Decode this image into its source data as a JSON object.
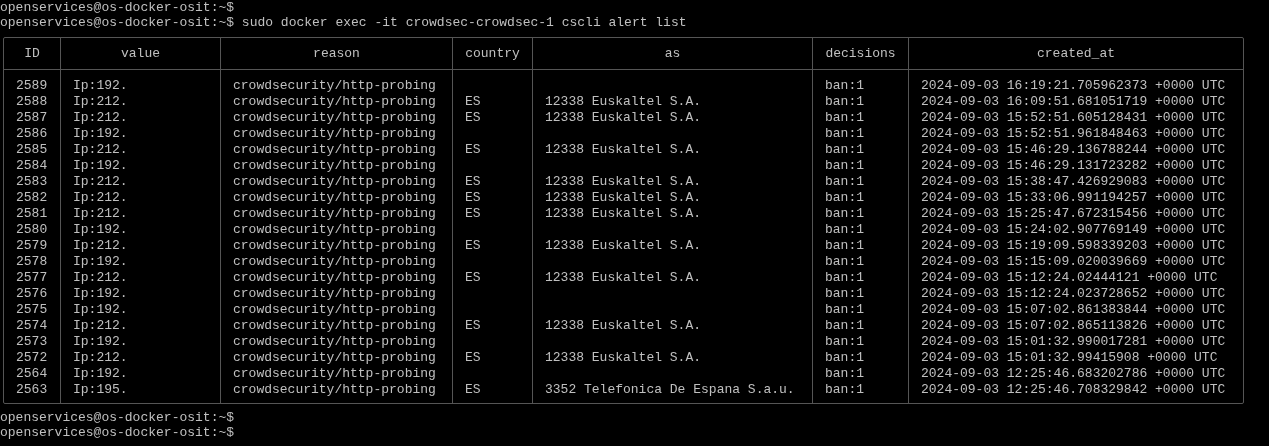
{
  "terminal": {
    "lines_before": [
      "openservices@os-docker-osit:~$",
      "openservices@os-docker-osit:~$ sudo docker exec -it crowdsec-crowdsec-1 cscli alert list"
    ],
    "table": {
      "columns": [
        "ID",
        "value",
        "reason",
        "country",
        "as",
        "decisions",
        "created_at"
      ],
      "rows": [
        {
          "id": "2589",
          "value": "Ip:192.",
          "reason": "crowdsecurity/http-probing",
          "decisions": "ban:1",
          "created_at": "2024-09-03 16:19:21.705962373 +0000 UTC"
        },
        {
          "id": "2588",
          "value": "Ip:212.",
          "reason": "crowdsecurity/http-probing",
          "country": "ES",
          "as": "12338 Euskaltel S.A.",
          "decisions": "ban:1",
          "created_at": "2024-09-03 16:09:51.681051719 +0000 UTC"
        },
        {
          "id": "2587",
          "value": "Ip:212.",
          "reason": "crowdsecurity/http-probing",
          "country": "ES",
          "as": "12338 Euskaltel S.A.",
          "decisions": "ban:1",
          "created_at": "2024-09-03 15:52:51.605128431 +0000 UTC"
        },
        {
          "id": "2586",
          "value": "Ip:192.",
          "reason": "crowdsecurity/http-probing",
          "decisions": "ban:1",
          "created_at": "2024-09-03 15:52:51.961848463 +0000 UTC"
        },
        {
          "id": "2585",
          "value": "Ip:212.",
          "reason": "crowdsecurity/http-probing",
          "country": "ES",
          "as": "12338 Euskaltel S.A.",
          "decisions": "ban:1",
          "created_at": "2024-09-03 15:46:29.136788244 +0000 UTC"
        },
        {
          "id": "2584",
          "value": "Ip:192.",
          "reason": "crowdsecurity/http-probing",
          "decisions": "ban:1",
          "created_at": "2024-09-03 15:46:29.131723282 +0000 UTC"
        },
        {
          "id": "2583",
          "value": "Ip:212.",
          "reason": "crowdsecurity/http-probing",
          "country": "ES",
          "as": "12338 Euskaltel S.A.",
          "decisions": "ban:1",
          "created_at": "2024-09-03 15:38:47.426929083 +0000 UTC"
        },
        {
          "id": "2582",
          "value": "Ip:212.",
          "reason": "crowdsecurity/http-probing",
          "country": "ES",
          "as": "12338 Euskaltel S.A.",
          "decisions": "ban:1",
          "created_at": "2024-09-03 15:33:06.991194257 +0000 UTC"
        },
        {
          "id": "2581",
          "value": "Ip:212.",
          "reason": "crowdsecurity/http-probing",
          "country": "ES",
          "as": "12338 Euskaltel S.A.",
          "decisions": "ban:1",
          "created_at": "2024-09-03 15:25:47.672315456 +0000 UTC"
        },
        {
          "id": "2580",
          "value": "Ip:192.",
          "reason": "crowdsecurity/http-probing",
          "decisions": "ban:1",
          "created_at": "2024-09-03 15:24:02.907769149 +0000 UTC"
        },
        {
          "id": "2579",
          "value": "Ip:212.",
          "reason": "crowdsecurity/http-probing",
          "country": "ES",
          "as": "12338 Euskaltel S.A.",
          "decisions": "ban:1",
          "created_at": "2024-09-03 15:19:09.598339203 +0000 UTC"
        },
        {
          "id": "2578",
          "value": "Ip:192.",
          "reason": "crowdsecurity/http-probing",
          "decisions": "ban:1",
          "created_at": "2024-09-03 15:15:09.020039669 +0000 UTC"
        },
        {
          "id": "2577",
          "value": "Ip:212.",
          "reason": "crowdsecurity/http-probing",
          "country": "ES",
          "as": "12338 Euskaltel S.A.",
          "decisions": "ban:1",
          "created_at": "2024-09-03 15:12:24.02444121 +0000 UTC"
        },
        {
          "id": "2576",
          "value": "Ip:192.",
          "reason": "crowdsecurity/http-probing",
          "decisions": "ban:1",
          "created_at": "2024-09-03 15:12:24.023728652 +0000 UTC"
        },
        {
          "id": "2575",
          "value": "Ip:192.",
          "reason": "crowdsecurity/http-probing",
          "decisions": "ban:1",
          "created_at": "2024-09-03 15:07:02.861383844 +0000 UTC"
        },
        {
          "id": "2574",
          "value": "Ip:212.",
          "reason": "crowdsecurity/http-probing",
          "country": "ES",
          "as": "12338 Euskaltel S.A.",
          "decisions": "ban:1",
          "created_at": "2024-09-03 15:07:02.865113826 +0000 UTC"
        },
        {
          "id": "2573",
          "value": "Ip:192.",
          "reason": "crowdsecurity/http-probing",
          "decisions": "ban:1",
          "created_at": "2024-09-03 15:01:32.990017281 +0000 UTC"
        },
        {
          "id": "2572",
          "value": "Ip:212.",
          "reason": "crowdsecurity/http-probing",
          "country": "ES",
          "as": "12338 Euskaltel S.A.",
          "decisions": "ban:1",
          "created_at": "2024-09-03 15:01:32.99415908 +0000 UTC"
        },
        {
          "id": "2564",
          "value": "Ip:192.",
          "reason": "crowdsecurity/http-probing",
          "decisions": "ban:1",
          "created_at": "2024-09-03 12:25:46.683202786 +0000 UTC"
        },
        {
          "id": "2563",
          "value": "Ip:195.",
          "reason": "crowdsecurity/http-probing",
          "country": "ES",
          "as": "3352 Telefonica De Espana S.a.u.",
          "decisions": "ban:1",
          "created_at": "2024-09-03 12:25:46.708329842 +0000 UTC"
        }
      ]
    },
    "lines_after": [
      "openservices@os-docker-osit:~$",
      "openservices@os-docker-osit:~$"
    ]
  }
}
